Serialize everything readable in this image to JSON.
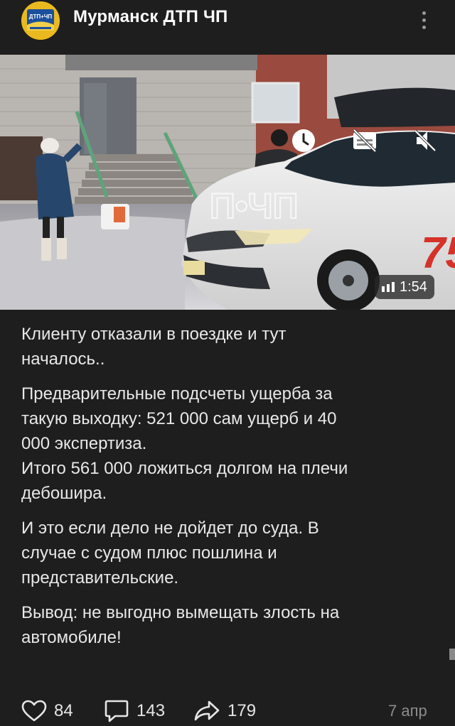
{
  "channel": {
    "name": "Мурманск ДТП  ЧП",
    "avatar_text": "ДТП+ЧП",
    "more_icon": "more-vertical-icon"
  },
  "video": {
    "duration": "1:54",
    "watermark": "П•ЧП",
    "car_number": "75",
    "controls": [
      "clock-icon",
      "subtitles-off-icon",
      "mute-icon"
    ]
  },
  "post": {
    "paragraphs": [
      "Клиенту отказали в поездке и тут\nначалось..",
      "Предварительные подсчеты ущерба за\nтакую выходку:  521 000 сам ущерб и 40\n000 экспертиза.\nИтого 561 000 ложиться долгом на плечи\nдебошира.",
      "И это если дело не дойдет до суда. В\nслучае с судом плюс пошлина и\nпредставительские.",
      "Вывод: не выгодно вымещать злость на\nавтомобиле!"
    ]
  },
  "footer": {
    "likes": "84",
    "comments": "143",
    "shares": "179",
    "date": "7 апр"
  }
}
